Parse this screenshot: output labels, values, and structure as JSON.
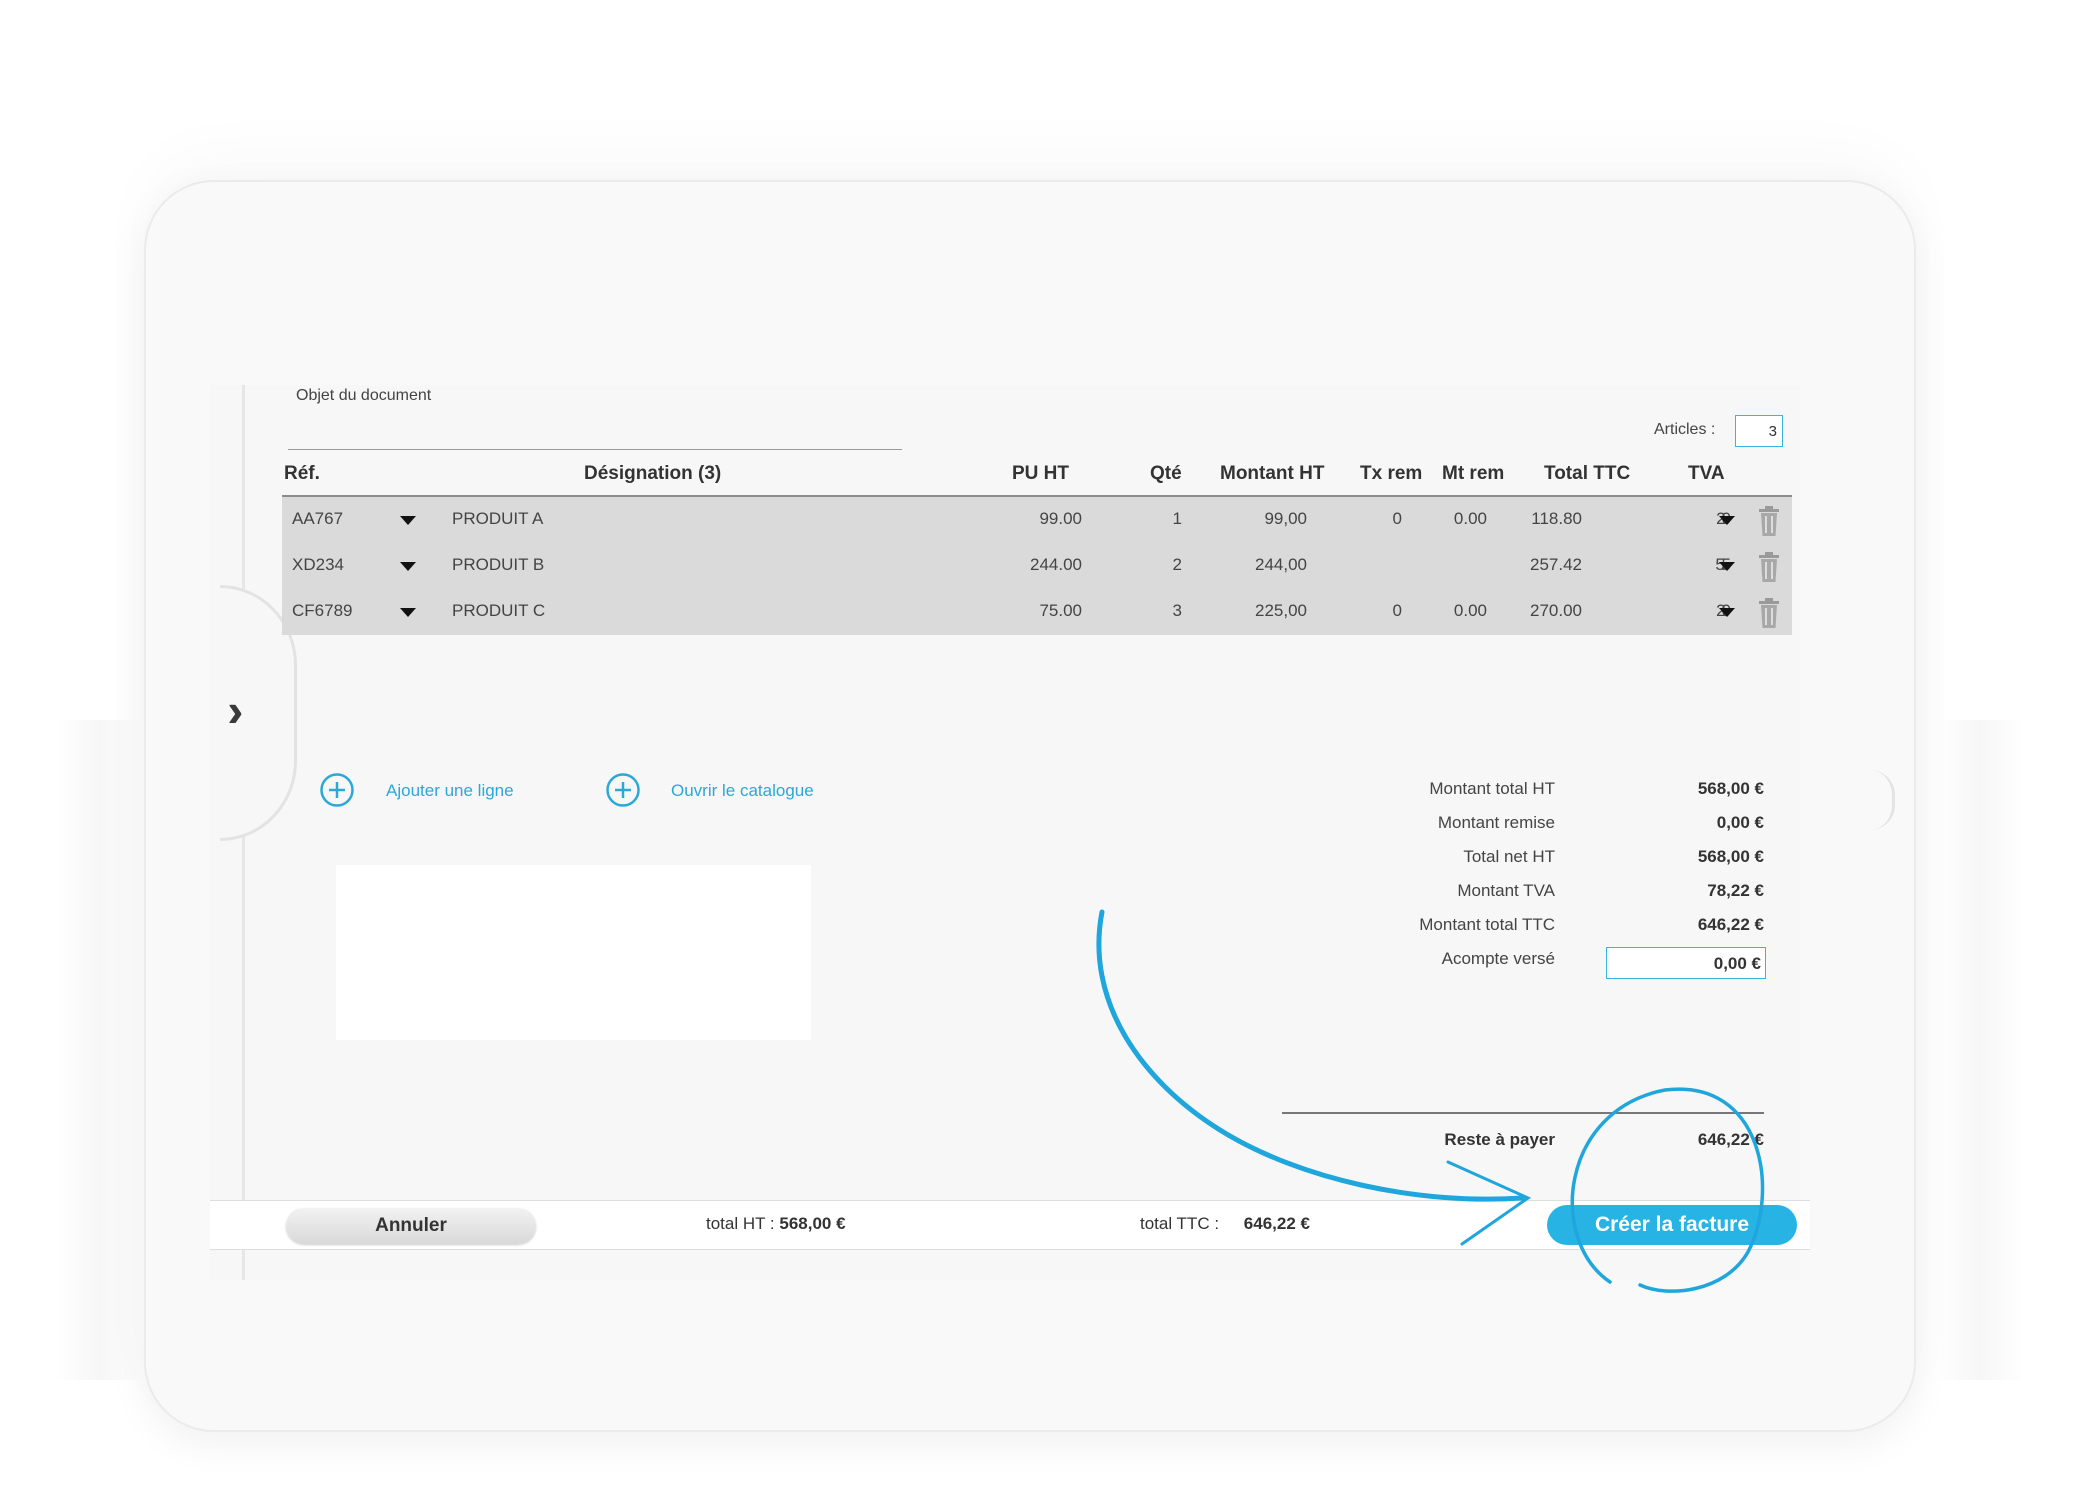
{
  "document": {
    "object_label": "Objet du document",
    "articles_label": "Articles :",
    "articles_value": "3"
  },
  "table": {
    "headers": {
      "ref": "Réf.",
      "designation": "Désignation (3)",
      "pu_ht": "PU HT",
      "qte": "Qté",
      "montant_ht": "Montant HT",
      "tx_rem": "Tx rem",
      "mt_rem": "Mt rem",
      "total_ttc": "Total TTC",
      "tva": "TVA"
    },
    "rows": [
      {
        "ref": "AA767",
        "designation": "PRODUIT A",
        "pu_ht": "99.00",
        "qte": "1",
        "montant_ht": "99,00",
        "tx_rem": "0",
        "mt_rem": "0.00",
        "total_ttc": "118.80",
        "tva": "20"
      },
      {
        "ref": "XD234",
        "designation": "PRODUIT B",
        "pu_ht": "244.00",
        "qte": "2",
        "montant_ht": "244,00",
        "tx_rem": "",
        "mt_rem": "",
        "total_ttc": "257.42",
        "tva": "5.5"
      },
      {
        "ref": "CF6789",
        "designation": "PRODUIT C",
        "pu_ht": "75.00",
        "qte": "3",
        "montant_ht": "225,00",
        "tx_rem": "0",
        "mt_rem": "0.00",
        "total_ttc": "270.00",
        "tva": "20"
      }
    ]
  },
  "actions": {
    "add_line": "Ajouter une ligne",
    "open_catalog": "Ouvrir le catalogue"
  },
  "totals": {
    "montant_total_ht_label": "Montant total HT",
    "montant_total_ht": "568,00 €",
    "montant_remise_label": "Montant remise",
    "montant_remise": "0,00 €",
    "total_net_ht_label": "Total net HT",
    "total_net_ht": "568,00 €",
    "montant_tva_label": "Montant TVA",
    "montant_tva": "78,22 €",
    "montant_total_ttc_label": "Montant total TTC",
    "montant_total_ttc": "646,22 €",
    "acompte_label": "Acompte versé",
    "acompte": "0,00 €",
    "reste_label": "Reste à payer",
    "reste": "646,22 €"
  },
  "footer": {
    "cancel": "Annuler",
    "total_ht_label": "total HT :",
    "total_ht": "568,00 €",
    "total_ttc_label": "total TTC :",
    "total_ttc": "646,22 €",
    "create_invoice": "Créer la facture"
  },
  "icons": {
    "expand": "double-chevron-right-icon",
    "dropdown": "caret-down-icon",
    "delete": "trash-icon",
    "add": "plus-circle-icon"
  },
  "colors": {
    "accent": "#27b4e4",
    "link": "#2aa8d8",
    "table_bg": "#dadada"
  }
}
